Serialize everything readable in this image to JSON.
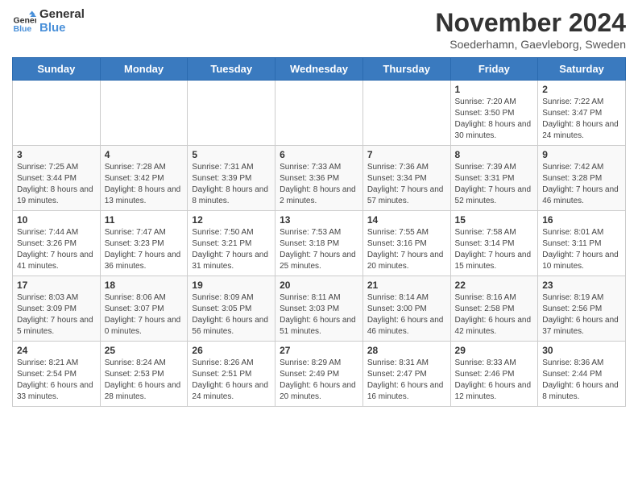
{
  "header": {
    "logo_line1": "General",
    "logo_line2": "Blue",
    "month_title": "November 2024",
    "location": "Soederhamn, Gaevleborg, Sweden"
  },
  "weekdays": [
    "Sunday",
    "Monday",
    "Tuesday",
    "Wednesday",
    "Thursday",
    "Friday",
    "Saturday"
  ],
  "weeks": [
    [
      {
        "day": "",
        "info": ""
      },
      {
        "day": "",
        "info": ""
      },
      {
        "day": "",
        "info": ""
      },
      {
        "day": "",
        "info": ""
      },
      {
        "day": "",
        "info": ""
      },
      {
        "day": "1",
        "info": "Sunrise: 7:20 AM\nSunset: 3:50 PM\nDaylight: 8 hours and 30 minutes."
      },
      {
        "day": "2",
        "info": "Sunrise: 7:22 AM\nSunset: 3:47 PM\nDaylight: 8 hours and 24 minutes."
      }
    ],
    [
      {
        "day": "3",
        "info": "Sunrise: 7:25 AM\nSunset: 3:44 PM\nDaylight: 8 hours and 19 minutes."
      },
      {
        "day": "4",
        "info": "Sunrise: 7:28 AM\nSunset: 3:42 PM\nDaylight: 8 hours and 13 minutes."
      },
      {
        "day": "5",
        "info": "Sunrise: 7:31 AM\nSunset: 3:39 PM\nDaylight: 8 hours and 8 minutes."
      },
      {
        "day": "6",
        "info": "Sunrise: 7:33 AM\nSunset: 3:36 PM\nDaylight: 8 hours and 2 minutes."
      },
      {
        "day": "7",
        "info": "Sunrise: 7:36 AM\nSunset: 3:34 PM\nDaylight: 7 hours and 57 minutes."
      },
      {
        "day": "8",
        "info": "Sunrise: 7:39 AM\nSunset: 3:31 PM\nDaylight: 7 hours and 52 minutes."
      },
      {
        "day": "9",
        "info": "Sunrise: 7:42 AM\nSunset: 3:28 PM\nDaylight: 7 hours and 46 minutes."
      }
    ],
    [
      {
        "day": "10",
        "info": "Sunrise: 7:44 AM\nSunset: 3:26 PM\nDaylight: 7 hours and 41 minutes."
      },
      {
        "day": "11",
        "info": "Sunrise: 7:47 AM\nSunset: 3:23 PM\nDaylight: 7 hours and 36 minutes."
      },
      {
        "day": "12",
        "info": "Sunrise: 7:50 AM\nSunset: 3:21 PM\nDaylight: 7 hours and 31 minutes."
      },
      {
        "day": "13",
        "info": "Sunrise: 7:53 AM\nSunset: 3:18 PM\nDaylight: 7 hours and 25 minutes."
      },
      {
        "day": "14",
        "info": "Sunrise: 7:55 AM\nSunset: 3:16 PM\nDaylight: 7 hours and 20 minutes."
      },
      {
        "day": "15",
        "info": "Sunrise: 7:58 AM\nSunset: 3:14 PM\nDaylight: 7 hours and 15 minutes."
      },
      {
        "day": "16",
        "info": "Sunrise: 8:01 AM\nSunset: 3:11 PM\nDaylight: 7 hours and 10 minutes."
      }
    ],
    [
      {
        "day": "17",
        "info": "Sunrise: 8:03 AM\nSunset: 3:09 PM\nDaylight: 7 hours and 5 minutes."
      },
      {
        "day": "18",
        "info": "Sunrise: 8:06 AM\nSunset: 3:07 PM\nDaylight: 7 hours and 0 minutes."
      },
      {
        "day": "19",
        "info": "Sunrise: 8:09 AM\nSunset: 3:05 PM\nDaylight: 6 hours and 56 minutes."
      },
      {
        "day": "20",
        "info": "Sunrise: 8:11 AM\nSunset: 3:03 PM\nDaylight: 6 hours and 51 minutes."
      },
      {
        "day": "21",
        "info": "Sunrise: 8:14 AM\nSunset: 3:00 PM\nDaylight: 6 hours and 46 minutes."
      },
      {
        "day": "22",
        "info": "Sunrise: 8:16 AM\nSunset: 2:58 PM\nDaylight: 6 hours and 42 minutes."
      },
      {
        "day": "23",
        "info": "Sunrise: 8:19 AM\nSunset: 2:56 PM\nDaylight: 6 hours and 37 minutes."
      }
    ],
    [
      {
        "day": "24",
        "info": "Sunrise: 8:21 AM\nSunset: 2:54 PM\nDaylight: 6 hours and 33 minutes."
      },
      {
        "day": "25",
        "info": "Sunrise: 8:24 AM\nSunset: 2:53 PM\nDaylight: 6 hours and 28 minutes."
      },
      {
        "day": "26",
        "info": "Sunrise: 8:26 AM\nSunset: 2:51 PM\nDaylight: 6 hours and 24 minutes."
      },
      {
        "day": "27",
        "info": "Sunrise: 8:29 AM\nSunset: 2:49 PM\nDaylight: 6 hours and 20 minutes."
      },
      {
        "day": "28",
        "info": "Sunrise: 8:31 AM\nSunset: 2:47 PM\nDaylight: 6 hours and 16 minutes."
      },
      {
        "day": "29",
        "info": "Sunrise: 8:33 AM\nSunset: 2:46 PM\nDaylight: 6 hours and 12 minutes."
      },
      {
        "day": "30",
        "info": "Sunrise: 8:36 AM\nSunset: 2:44 PM\nDaylight: 6 hours and 8 minutes."
      }
    ]
  ]
}
